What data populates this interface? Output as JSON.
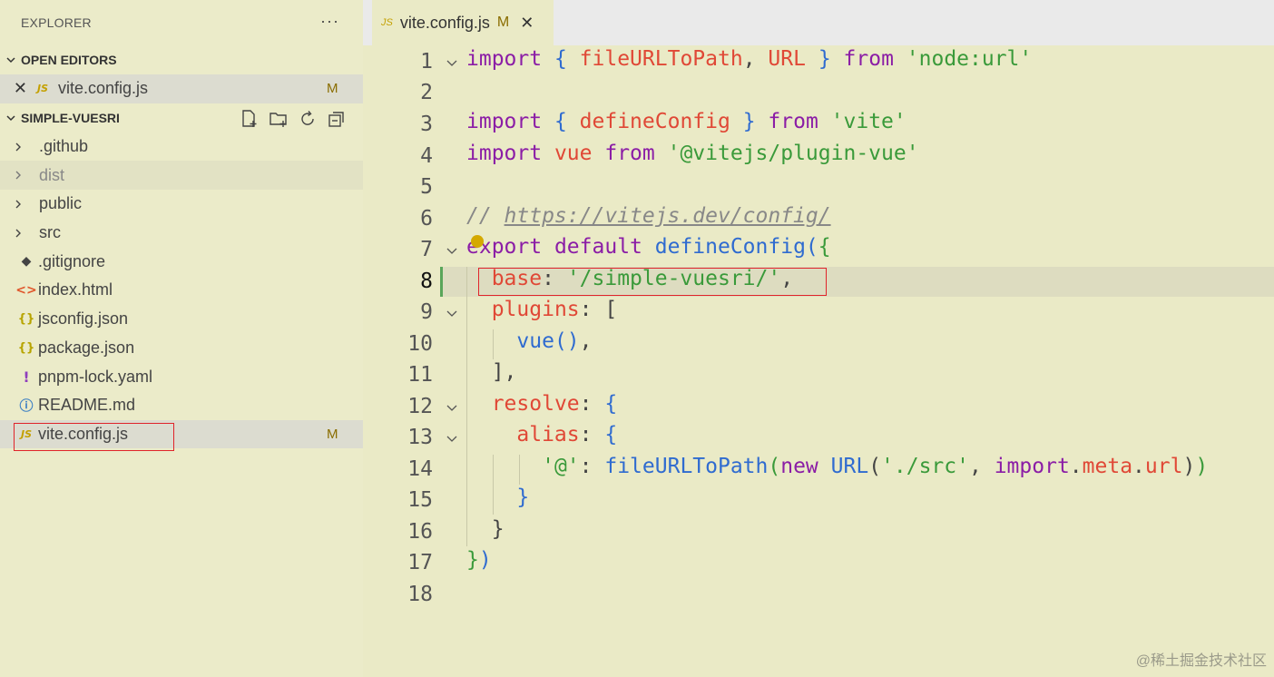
{
  "sidebar": {
    "title": "EXPLORER",
    "more": "···",
    "open_editors": {
      "header": "OPEN EDITORS",
      "items": [
        {
          "icon": "JS",
          "label": "vite.config.js",
          "badge": "M"
        }
      ]
    },
    "project": {
      "header": "SIMPLE-VUESRI",
      "items": [
        {
          "type": "folder",
          "label": ".github"
        },
        {
          "type": "folder",
          "label": "dist"
        },
        {
          "type": "folder",
          "label": "public"
        },
        {
          "type": "folder",
          "label": "src"
        },
        {
          "type": "file",
          "icon": "git",
          "label": ".gitignore"
        },
        {
          "type": "file",
          "icon": "<>",
          "label": "index.html"
        },
        {
          "type": "file",
          "icon": "{}",
          "label": "jsconfig.json"
        },
        {
          "type": "file",
          "icon": "{}",
          "label": "package.json"
        },
        {
          "type": "file",
          "icon": "!",
          "label": "pnpm-lock.yaml"
        },
        {
          "type": "file",
          "icon": "i",
          "label": "README.md"
        },
        {
          "type": "file",
          "icon": "JS",
          "label": "vite.config.js",
          "badge": "M"
        }
      ]
    }
  },
  "tab": {
    "icon": "JS",
    "label": "vite.config.js",
    "badge": "M",
    "close": "✕"
  },
  "editor": {
    "line_numbers": [
      "1",
      "2",
      "3",
      "4",
      "5",
      "6",
      "7",
      "8",
      "9",
      "10",
      "11",
      "12",
      "13",
      "14",
      "15",
      "16",
      "17",
      "18"
    ]
  },
  "watermark": "@稀土掘金技术社区",
  "colors": {
    "highlight_box": "#e0242a",
    "keyword": "#8b1da6",
    "string": "#3a9a3a",
    "identifier": "#e04836",
    "function": "#2f6bd0"
  }
}
